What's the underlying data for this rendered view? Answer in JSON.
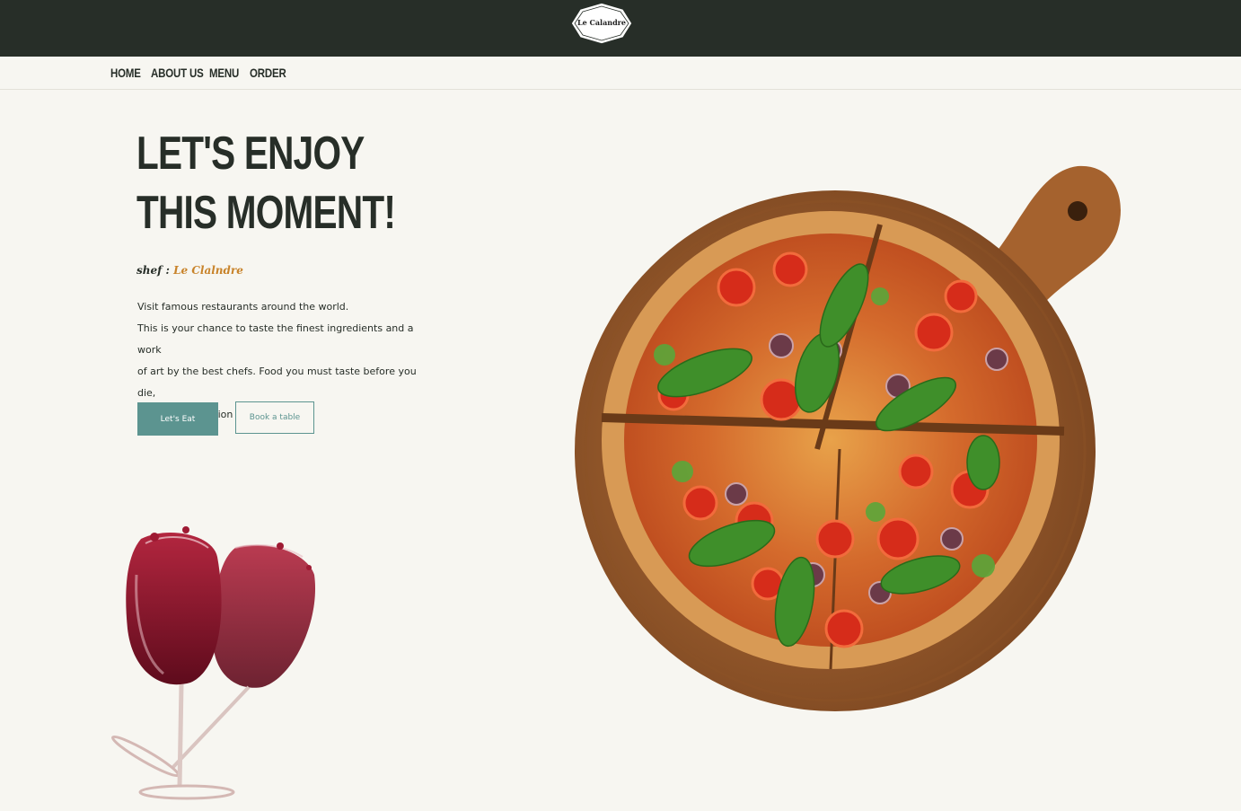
{
  "header": {
    "logo_text": "Le Calandre"
  },
  "nav": {
    "items": [
      "HOME",
      "ABOUT US",
      "MENU",
      "ORDER"
    ]
  },
  "hero": {
    "title_line1": "LET'S ENJOY",
    "title_line2": "THIS MOMENT!",
    "chef_label": "shef :",
    "chef_name": "Le Clalndre",
    "description": [
      "Visit famous restaurants around the world.",
      "This is your chance to taste the finest ingredients and a work",
      "of art by the best chefs. Food you must taste before you die,",
      "make a reservation"
    ],
    "primary_button": "Let's Eat",
    "secondary_button": "Book a table"
  },
  "colors": {
    "header_bg": "#272e28",
    "page_bg": "#f7f6f1",
    "accent_teal": "#5c9490",
    "chef_accent": "#c8832a",
    "text_dark": "#272e28"
  },
  "images": {
    "wine": "wine-glasses-image",
    "pizza": "pizza-on-board-image"
  }
}
